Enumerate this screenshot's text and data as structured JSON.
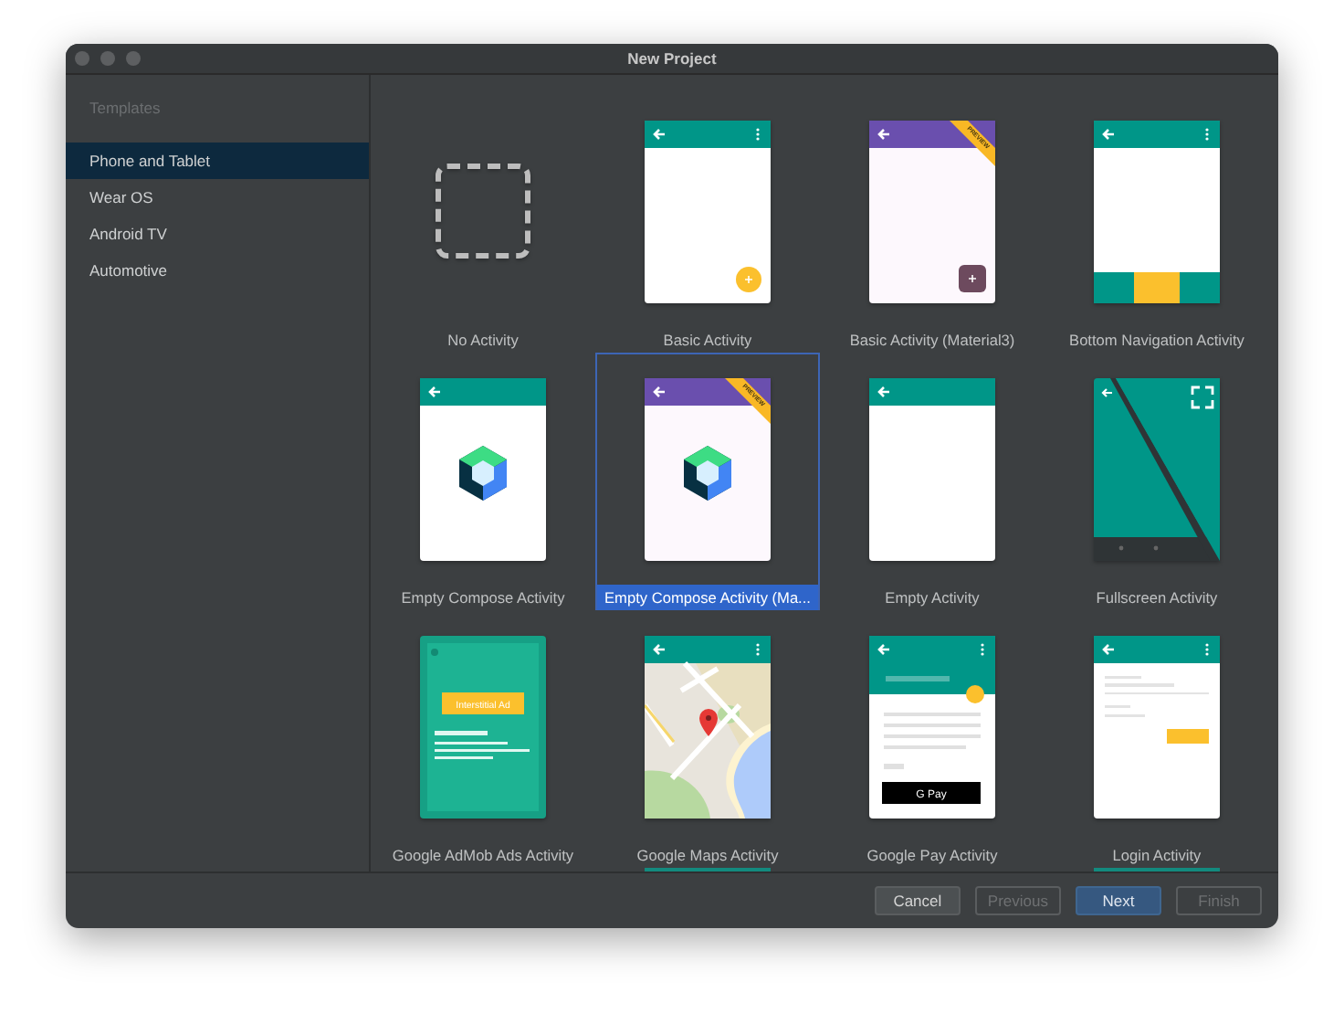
{
  "window": {
    "title": "New Project"
  },
  "sidebar": {
    "heading": "Templates",
    "items": [
      {
        "label": "Phone and Tablet",
        "selected": true
      },
      {
        "label": "Wear OS",
        "selected": false
      },
      {
        "label": "Android TV",
        "selected": false
      },
      {
        "label": "Automotive",
        "selected": false
      }
    ]
  },
  "templates": [
    {
      "label": "No Activity",
      "kind": "none",
      "selected": false
    },
    {
      "label": "Basic Activity",
      "kind": "basic",
      "selected": false
    },
    {
      "label": "Basic Activity (Material3)",
      "kind": "basicm3",
      "selected": false,
      "badge": "PREVIEW"
    },
    {
      "label": "Bottom Navigation Activity",
      "kind": "bottomnav",
      "selected": false
    },
    {
      "label": "Empty Compose Activity",
      "kind": "compose",
      "selected": false
    },
    {
      "label": "Empty Compose Activity (Ma...",
      "kind": "composem3",
      "selected": true,
      "badge": "PREVIEW"
    },
    {
      "label": "Empty Activity",
      "kind": "empty",
      "selected": false
    },
    {
      "label": "Fullscreen Activity",
      "kind": "fullscreen",
      "selected": false
    },
    {
      "label": "Google AdMob Ads Activity",
      "kind": "admob",
      "selected": false,
      "thumb_text": "Interstitial Ad"
    },
    {
      "label": "Google Maps Activity",
      "kind": "maps",
      "selected": false
    },
    {
      "label": "Google Pay Activity",
      "kind": "pay",
      "selected": false,
      "thumb_text": "G Pay"
    },
    {
      "label": "Login Activity",
      "kind": "login",
      "selected": false
    }
  ],
  "next_row_peek": [
    false,
    true,
    false,
    true
  ],
  "buttons": [
    {
      "label": "Cancel",
      "disabled": false,
      "default": false
    },
    {
      "label": "Previous",
      "disabled": true,
      "default": false
    },
    {
      "label": "Next",
      "disabled": false,
      "default": true
    },
    {
      "label": "Finish",
      "disabled": true,
      "default": false
    }
  ]
}
